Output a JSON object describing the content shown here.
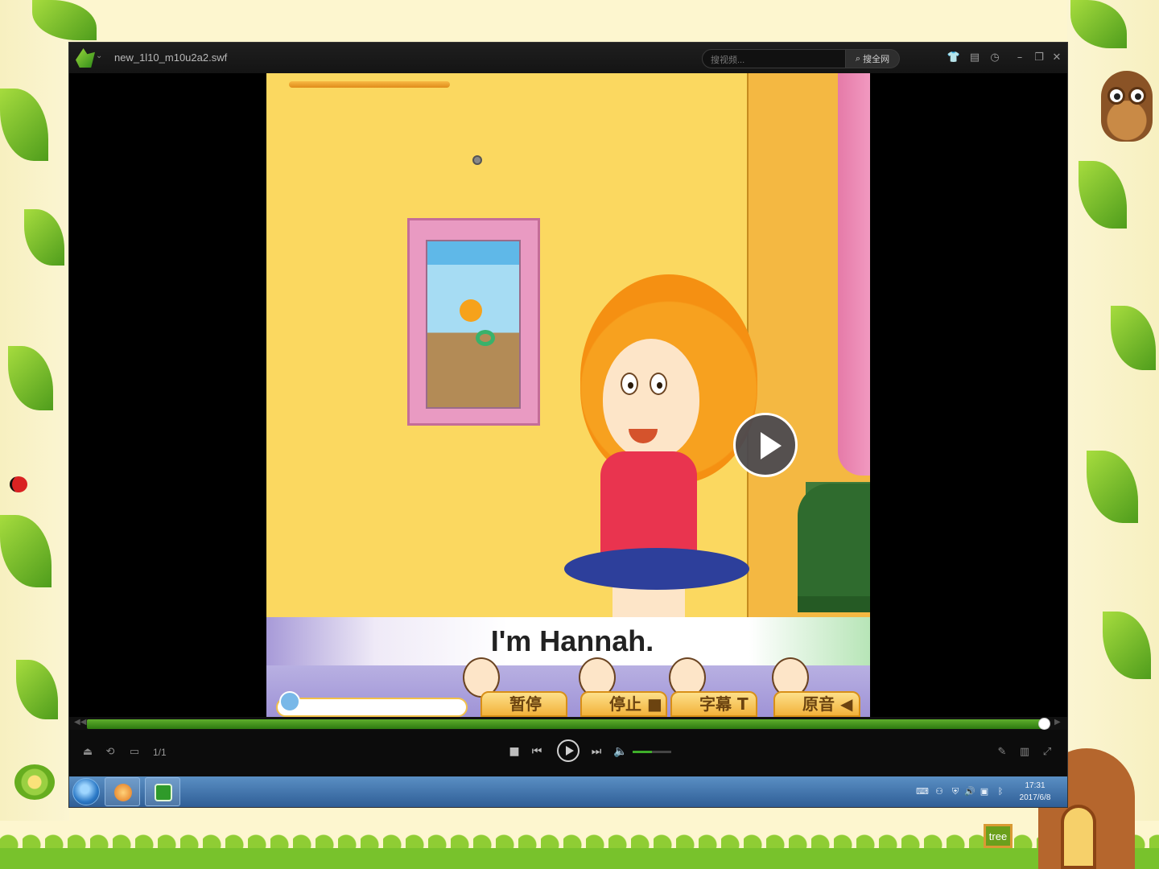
{
  "window": {
    "file_title": "new_1l10_m10u2a2.swf",
    "search_placeholder": "搜视频...",
    "search_button_label": "搜全网"
  },
  "video": {
    "subtitle": "I'm Hannah.",
    "swf_buttons": [
      {
        "label": "暂停",
        "icon": "pause-icon"
      },
      {
        "label": "停止",
        "icon": "stop-icon"
      },
      {
        "label": "字幕",
        "icon": "text-icon"
      },
      {
        "label": "原音",
        "icon": "speaker-icon"
      }
    ]
  },
  "playback": {
    "progress": 0.995,
    "volume": 0.5,
    "playlist_count": "1/1"
  },
  "taskbar": {
    "time": "17:31",
    "date": "2017/6/8"
  },
  "decor": {
    "sign_text": "tree"
  },
  "colors": {
    "accent_green": "#3fae2a",
    "taskbar_blue": "#2f5e96",
    "slide_bg": "#fdf6cf"
  }
}
